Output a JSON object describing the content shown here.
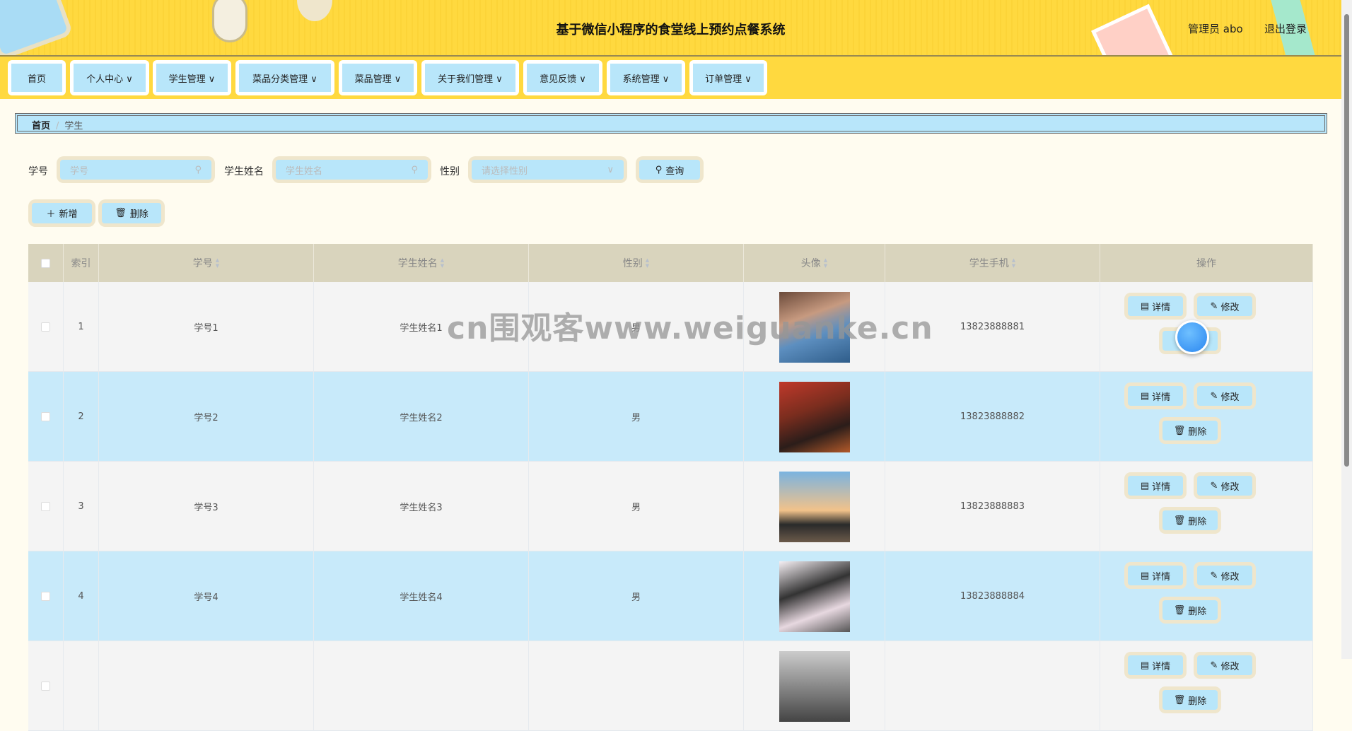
{
  "header": {
    "title": "基于微信小程序的食堂线上预约点餐系统",
    "user": "管理员 abo",
    "logout": "退出登录"
  },
  "nav": [
    {
      "label": "首页"
    },
    {
      "label": "个人中心 ∨"
    },
    {
      "label": "学生管理 ∨"
    },
    {
      "label": "菜品分类管理 ∨"
    },
    {
      "label": "菜品管理 ∨"
    },
    {
      "label": "关于我们管理 ∨"
    },
    {
      "label": "意见反馈 ∨"
    },
    {
      "label": "系统管理 ∨"
    },
    {
      "label": "订单管理 ∨"
    }
  ],
  "breadcrumb": {
    "home": "首页",
    "sep": "/",
    "current": "学生"
  },
  "search": {
    "id_label": "学号",
    "id_placeholder": "学号",
    "name_label": "学生姓名",
    "name_placeholder": "学生姓名",
    "gender_label": "性别",
    "gender_placeholder": "请选择性别",
    "query": "查询"
  },
  "actions": {
    "add": "新增",
    "delete": "删除"
  },
  "table": {
    "headers": [
      "索引",
      "学号",
      "学生姓名",
      "性别",
      "头像",
      "学生手机",
      "操作"
    ],
    "rows": [
      {
        "index": "1",
        "id": "学号1",
        "name": "学生姓名1",
        "gender": "男",
        "phone": "13823888881"
      },
      {
        "index": "2",
        "id": "学号2",
        "name": "学生姓名2",
        "gender": "男",
        "phone": "13823888882"
      },
      {
        "index": "3",
        "id": "学号3",
        "name": "学生姓名3",
        "gender": "男",
        "phone": "13823888883"
      },
      {
        "index": "4",
        "id": "学号4",
        "name": "学生姓名4",
        "gender": "男",
        "phone": "13823888884"
      },
      {
        "index": "",
        "id": "",
        "name": "",
        "gender": "",
        "phone": ""
      }
    ],
    "ops": {
      "detail": "详情",
      "edit": "修改",
      "delete": "删除"
    }
  },
  "watermark": "cn围观客www.weiguanke.cn",
  "colors": {
    "header": "#ffd93f",
    "button": "#b8e6fa",
    "row_alt": "#c8eafa"
  }
}
